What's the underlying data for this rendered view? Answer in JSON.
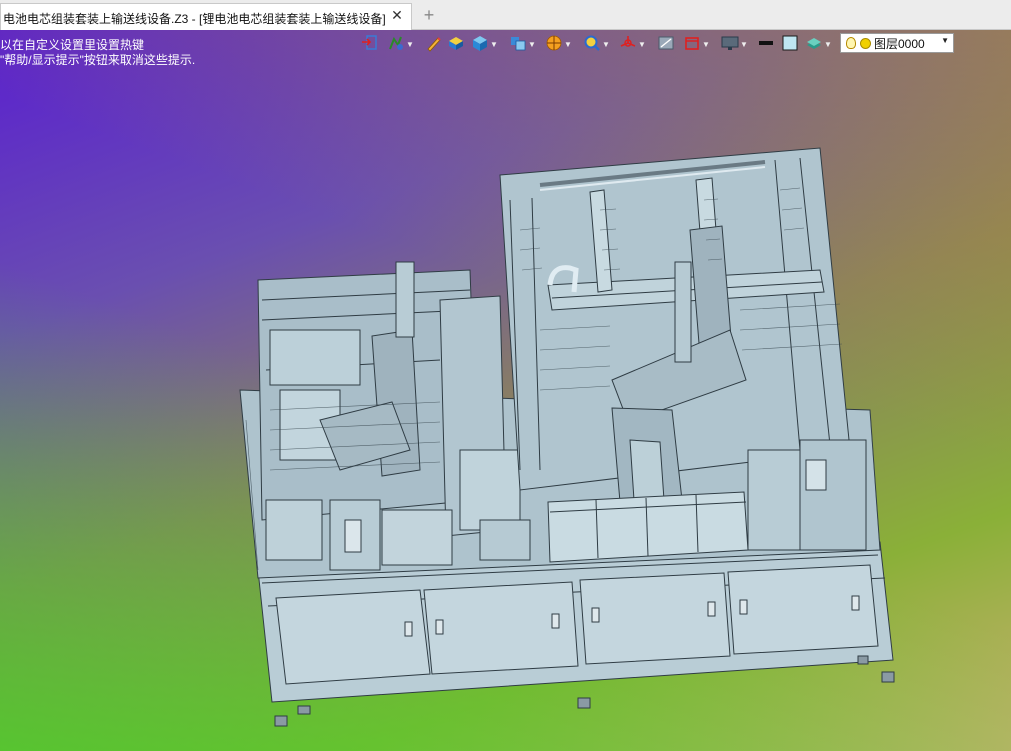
{
  "tabs": [
    {
      "label": "电池电芯组装套装上输送线设备.Z3 - [锂电池电芯组装套装上输送线设备]",
      "active": true,
      "close_icon": "close-icon"
    }
  ],
  "tab_add_icon": "plus-icon",
  "tab_add_glyph": "+",
  "tab_close_glyph": "✕",
  "viewport": {
    "hint_line1": "以在自定义设置里设置热键",
    "hint_line2": "\"帮助/显示提示\"按钮来取消这些提示.",
    "background_colors": [
      "#5a1fd0",
      "#8a8060",
      "#46d228",
      "#c8b070"
    ]
  },
  "toolbar": {
    "buttons": [
      {
        "name": "exit-sketch-icon",
        "dropdown": false
      },
      {
        "name": "pick-filter-icon",
        "dropdown": true
      },
      {
        "name": "pencil-icon",
        "dropdown": false
      },
      {
        "name": "shade-toggle-icon",
        "dropdown": false
      },
      {
        "name": "cube-view-icon",
        "dropdown": true
      },
      {
        "name": "multi-view-icon",
        "dropdown": true
      },
      {
        "name": "render-mode-icon",
        "dropdown": true
      },
      {
        "name": "zoom-icon",
        "dropdown": true
      },
      {
        "name": "triad-icon",
        "dropdown": true
      },
      {
        "name": "section-view-icon",
        "dropdown": false
      },
      {
        "name": "clip-plane-icon",
        "dropdown": true
      },
      {
        "name": "monitor-icon",
        "dropdown": true
      },
      {
        "name": "line-style-icon",
        "dropdown": false
      },
      {
        "name": "color-swatch-icon",
        "dropdown": false
      },
      {
        "name": "layer-manager-icon",
        "dropdown": true
      }
    ],
    "layer_select": {
      "value": "图层0000",
      "caret": "▼"
    }
  },
  "model": {
    "description_icon": "cad-assembly-model",
    "body_color": "#b4c8d2"
  }
}
